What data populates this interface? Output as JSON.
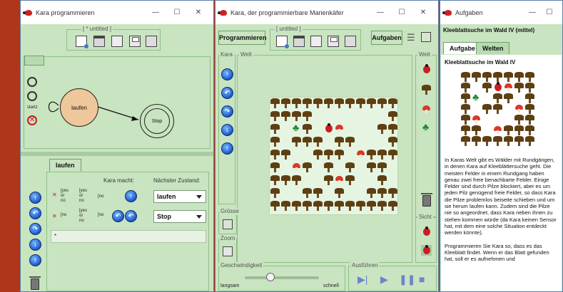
{
  "win1": {
    "title": "Kara programmieren",
    "file_label": "[ * untitled ]",
    "state_tools": {
      "start_label": "startz"
    },
    "states": {
      "laufen": "laufen",
      "stop": "Stop"
    },
    "active_tab": "laufen",
    "headers": {
      "kara_macht": "Kara macht:",
      "next_state": "Nächster Zustand:"
    },
    "cond_words": {
      "yes": "yes",
      "or": "or",
      "no": "no"
    },
    "transitions": [
      {
        "next": "laufen"
      },
      {
        "next": "Stop"
      }
    ],
    "wildcard": "*"
  },
  "win2": {
    "title": "Kara, der programmierbare Marienkäfer",
    "programmieren": "Programmieren",
    "file_label": "[ untitled ]",
    "aufgaben": "Aufgaben",
    "legend_kara": "Kara",
    "legend_welt": "Welt",
    "legend_welt_right": "Welt",
    "legend_groesse": "Grösse",
    "legend_zoom": "Zoom",
    "legend_sicht": "Sicht",
    "legend_speed": "Geschwindigkeit",
    "speed_slow": "langsam",
    "speed_fast": "schnell",
    "legend_run": "Ausführen",
    "speed_value": 0.35
  },
  "win3": {
    "title": "Aufgaben",
    "task_name": "Kleeblattsuche im Wald IV (mittel)",
    "tabs": [
      "Aufgabe",
      "Welten"
    ],
    "heading": "Kleeblattsuche im Wald IV",
    "paragraphs": [
      "In Karas Welt gibt es Wälder mit Rundgängen, in denen Kara auf Kleeblättersuche geht. Die meisten Felder in einem Rundgang haben genau zwei freie benachbarte Felder. Einige Felder sind durch Pilze blockiert, aber es um jeden Pilz genügend freie Felder, so dass Kara die Pilze problemlos beiseite schieben und um sie herum laufen kann. Zudem sind die Pilze nie so angeordnet, dass Kara neben ihnen zu stehen kommen würde (da Kara keinen Sensor hat, mit dem eine solche Situation entdeckt werden könnte).",
      "Programmieren Sie Kara so, dass es das Kleeblatt findet. Wenn er das Blatt gefunden hat, soll er es aufnehmen und"
    ]
  },
  "window_controls": {
    "min": "—",
    "max": "☐",
    "close": "✕"
  }
}
